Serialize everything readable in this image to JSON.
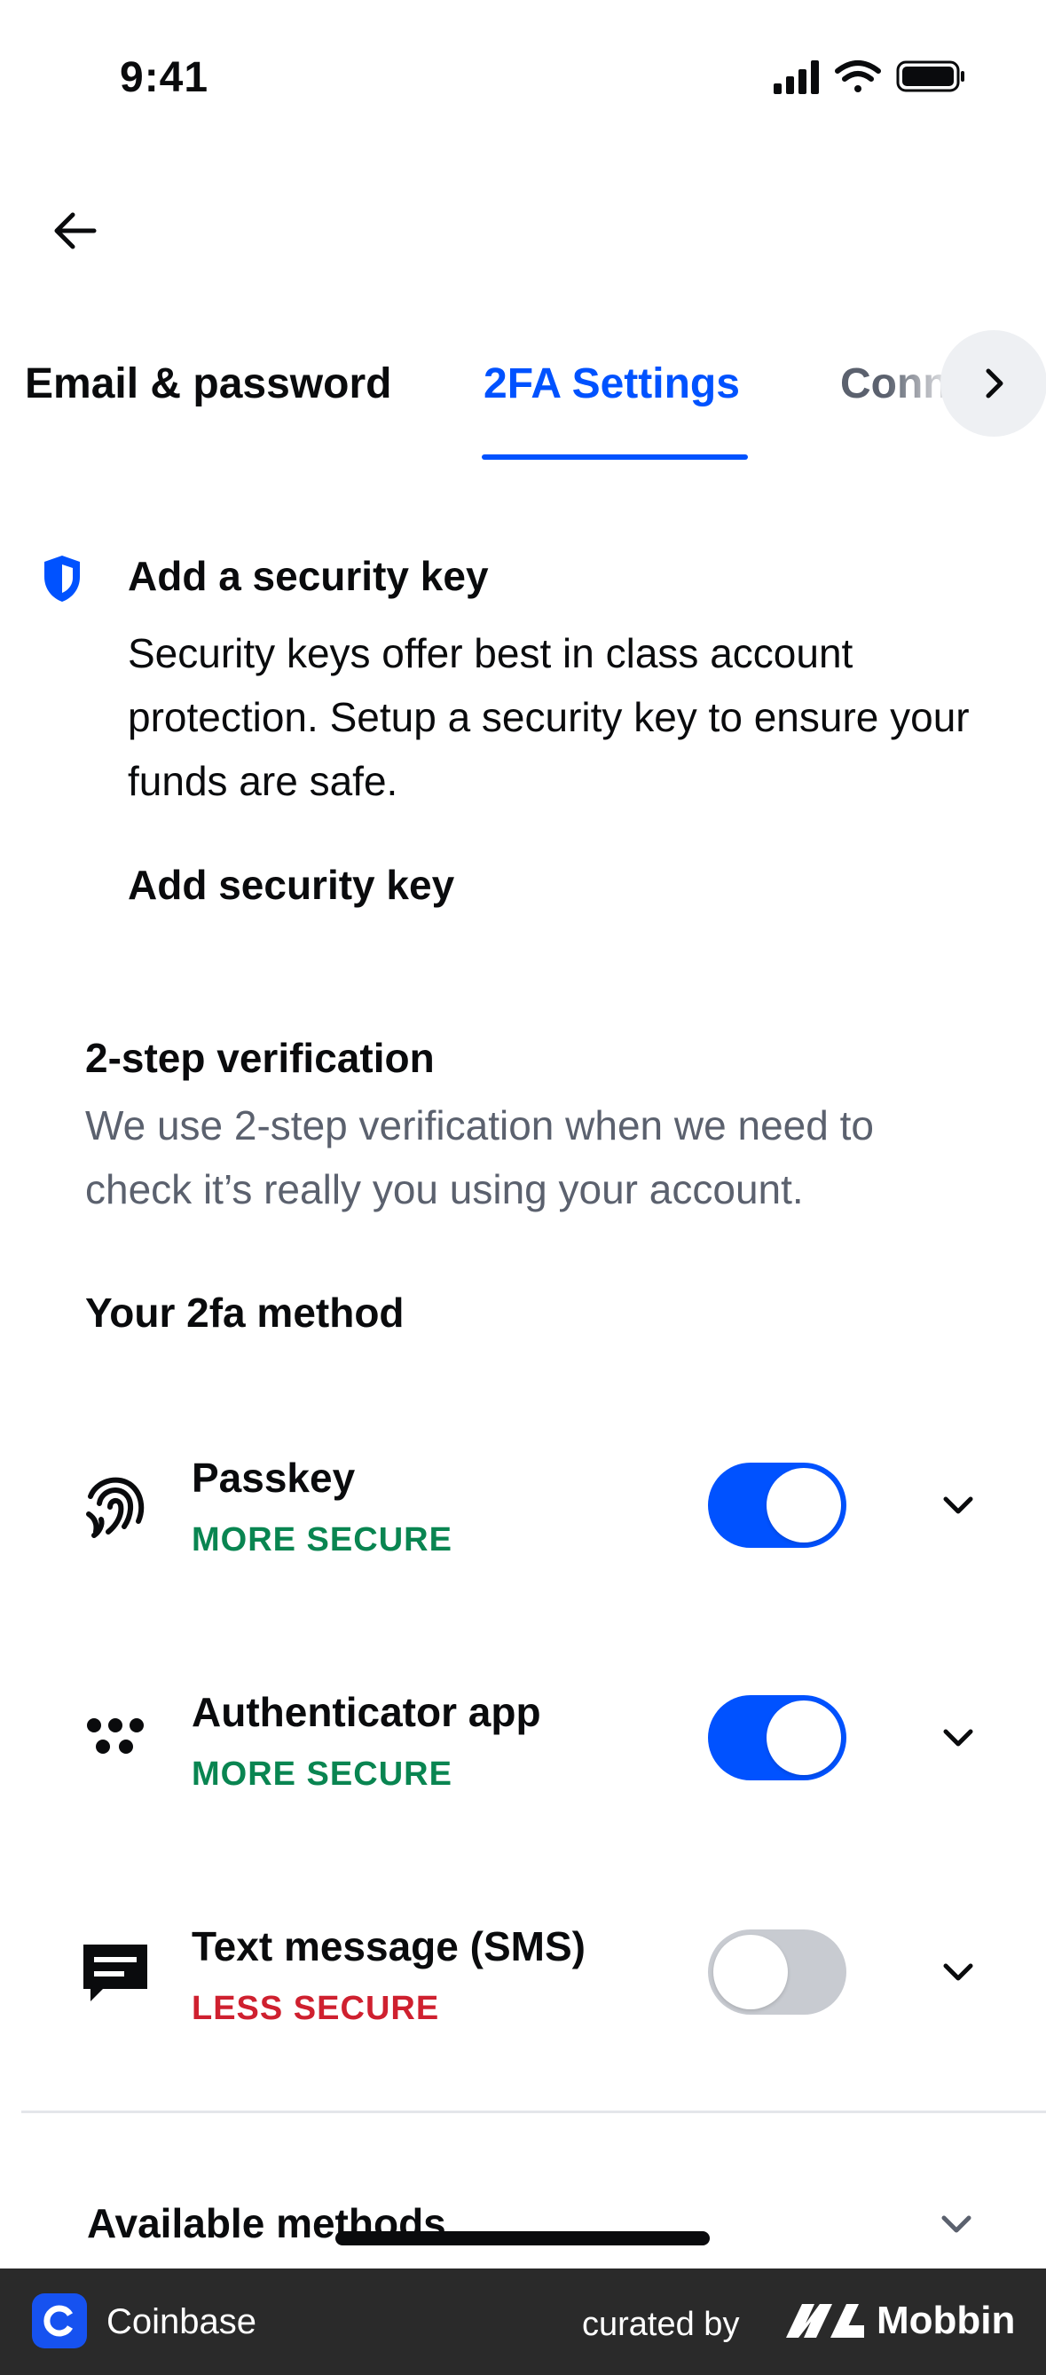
{
  "status_bar": {
    "time": "9:41"
  },
  "tabs": [
    {
      "label": "Email & password",
      "active": false
    },
    {
      "label": "2FA Settings",
      "active": true
    },
    {
      "label": "Conn",
      "active": false
    }
  ],
  "security_key": {
    "title": "Add a security key",
    "description": "Security keys offer best in class account protection. Setup a security key to ensure your funds are safe.",
    "action": "Add security key",
    "icon": "shield-icon"
  },
  "two_step": {
    "title": "2-step verification",
    "description": "We use 2-step verification when we need to check it’s really you using your account.",
    "method_heading": "Your 2fa method"
  },
  "methods": [
    {
      "name": "Passkey",
      "badge": "MORE SECURE",
      "enabled": true,
      "icon": "fingerprint-icon"
    },
    {
      "name": "Authenticator app",
      "badge": "MORE SECURE",
      "enabled": true,
      "icon": "dots-icon"
    },
    {
      "name": "Text message (SMS)",
      "badge": "LESS SECURE",
      "enabled": false,
      "icon": "chat-bubble-icon"
    }
  ],
  "available": {
    "label": "Available methods"
  },
  "footer": {
    "brand": "Coinbase",
    "curated_by": "curated by",
    "mobbin": "Mobbin"
  },
  "colors": {
    "accent": "#0052ff",
    "more_secure": "#098551",
    "less_secure": "#cf202f"
  }
}
